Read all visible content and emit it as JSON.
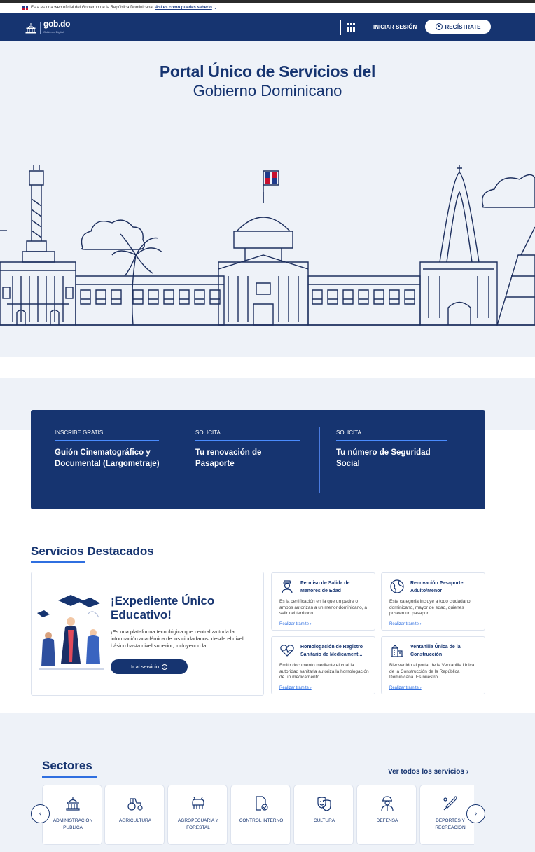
{
  "gov_bar": {
    "notice": "Esta es una web oficial del Gobierno de la República Dominicana",
    "how_link": "Así es como puedes saberlo"
  },
  "navbar": {
    "logo_text": "gob.do",
    "logo_subtext": "Gobierno Digital",
    "login_label": "INICIAR SESIÓN",
    "register_label": "REGÍSTRATE"
  },
  "hero": {
    "title_line1": "Portal Único de Servicios del",
    "title_line2": "Gobierno Dominicano"
  },
  "promo": [
    {
      "tag": "INSCRIBE GRATIS",
      "title": "Guión Cinematográfico y Documental (Largometraje)"
    },
    {
      "tag": "SOLICITA",
      "title": "Tu renovación de Pasaporte"
    },
    {
      "tag": "SOLICITA",
      "title": "Tu número de Seguridad Social"
    }
  ],
  "featured_section": {
    "title": "Servicios Destacados",
    "main": {
      "title": "¡Expediente Único Educativo!",
      "description": "¡Es una plataforma tecnológica que centraliza toda la información académica de los ciudadanos, desde el nivel básico hasta nivel superior, incluyendo la...",
      "button": "Ir al servicio"
    },
    "cards": [
      {
        "icon": "officer-icon",
        "title": "Permiso de Salida de Menores de Edad",
        "description": "Es la certificación en la que un padre o ambos autorizan a un menor dominicano, a salir del territorio...",
        "link": "Realizar trámite"
      },
      {
        "icon": "globe-icon",
        "title": "Renovación Pasaporte Adulto/Menor",
        "description": "Esta categoría incluye a todo ciudadano dominicano, mayor de edad, quienes poseen un pasaport...",
        "link": "Realizar trámite"
      },
      {
        "icon": "heartbeat-icon",
        "title": "Homologación de Registro Sanitario de Medicament...",
        "description": "Emitir documento mediante el cual la autoridad sanitaria autoriza la homologación de un medicamento...",
        "link": "Realizar trámite"
      },
      {
        "icon": "building-icon",
        "title": "Ventanilla Única de la Construcción",
        "description": "Bienvenido al portal de la Ventanilla Única de la Construcción de la República Dominicana. Es nuestro...",
        "link": "Realizar trámite"
      }
    ]
  },
  "sectors_section": {
    "title": "Sectores",
    "see_all": "Ver todos los servicios",
    "items": [
      {
        "icon": "capitol-icon",
        "label": "ADMINISTRACIÓN PÚBLICA"
      },
      {
        "icon": "tractor-icon",
        "label": "AGRICULTURA"
      },
      {
        "icon": "livestock-icon",
        "label": "AGROPECUARIA Y FORESTAL"
      },
      {
        "icon": "document-check-icon",
        "label": "CONTROL INTERNO"
      },
      {
        "icon": "theater-masks-icon",
        "label": "CULTURA"
      },
      {
        "icon": "soldier-icon",
        "label": "DEFENSA"
      },
      {
        "icon": "baseball-bat-icon",
        "label": "DEPORTES Y RECREACIÓN"
      }
    ]
  },
  "colors": {
    "navy": "#163470",
    "accent_blue": "#2f6fe0",
    "background": "#eef2f8"
  }
}
